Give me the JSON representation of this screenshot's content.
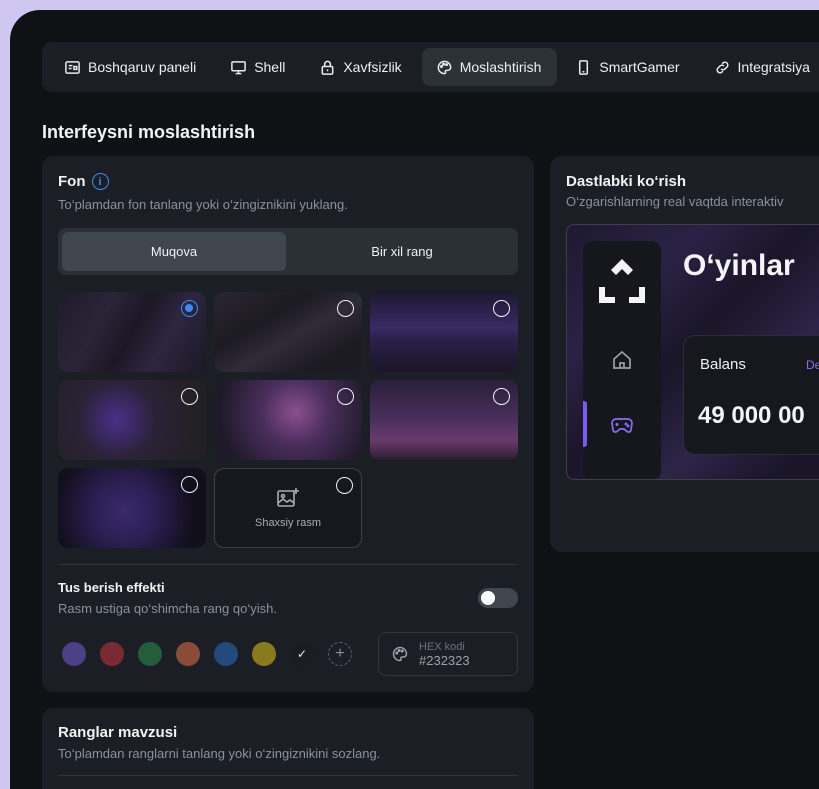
{
  "tabs": [
    {
      "label": "Boshqaruv paneli",
      "icon": "dashboard-icon"
    },
    {
      "label": "Shell",
      "icon": "monitor-icon"
    },
    {
      "label": "Xavfsizlik",
      "icon": "lock-icon"
    },
    {
      "label": "Moslashtirish",
      "icon": "palette-icon",
      "active": true
    },
    {
      "label": "SmartGamer",
      "icon": "phone-icon"
    },
    {
      "label": "Integratsiya",
      "icon": "link-icon"
    }
  ],
  "page_title": "Interfeysni moslashtirish",
  "fon": {
    "title": "Fon",
    "subtitle": "To‘plamdan fon tanlang yoki o‘zingiznikini yuklang.",
    "segments": [
      "Muqova",
      "Bir xil rang"
    ],
    "selected_segment": "Muqova",
    "custom_image_label": "Shaxsiy rasm",
    "tint_title": "Tus berish effekti",
    "tint_subtitle": "Rasm ustiga qo‘shimcha rang qo‘yish.",
    "tint_enabled": false,
    "swatch_colors": [
      "#4b3f86",
      "#7a2a33",
      "#255c3c",
      "#8a4c38",
      "#23497d",
      "#8a7a1f"
    ],
    "selected_swatch": "#1a1d21",
    "hex_label": "HEX kodi",
    "hex_value": "#232323"
  },
  "ranglar": {
    "title": "Ranglar mavzusi",
    "subtitle": "To‘plamdan ranglarni tanlang yoki o‘zingiznikini sozlang."
  },
  "preview": {
    "title": "Dastlabki ko‘rish",
    "subtitle": "O‘zgarishlarning real vaqtda interaktiv",
    "heading": "O‘yinlar",
    "balance_label": "Balans",
    "balance_link": "De",
    "balance_value": "49 000 00",
    "accent": "#7b5cf0"
  }
}
